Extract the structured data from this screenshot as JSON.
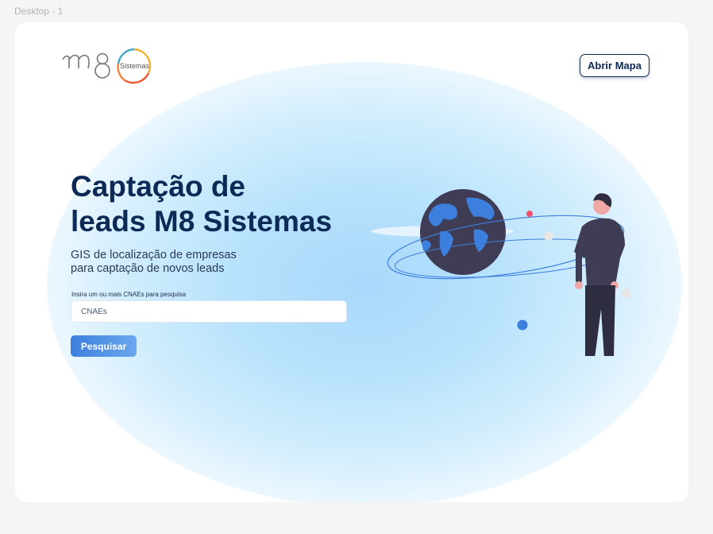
{
  "canvas": {
    "label": "Desktop - 1"
  },
  "header": {
    "logo_text": "Sistemas",
    "map_button_label": "Abrir Mapa"
  },
  "hero": {
    "title_line1": "Captação de",
    "title_line2": "leads M8 Sistemas",
    "subtitle_line1": "GIS de localização de empresas",
    "subtitle_line2": "para captação de novos leads"
  },
  "search": {
    "label": "Insira um ou mais CNAEs para pesquisa",
    "placeholder": "CNAEs",
    "button_label": "Pesquisar"
  },
  "illustration": {
    "icon": "man-with-globe-illustration"
  },
  "colors": {
    "brand_navy": "#0c2a55",
    "accent_blue": "#3d7fdd",
    "glow_blue": "#a9d8fb"
  }
}
